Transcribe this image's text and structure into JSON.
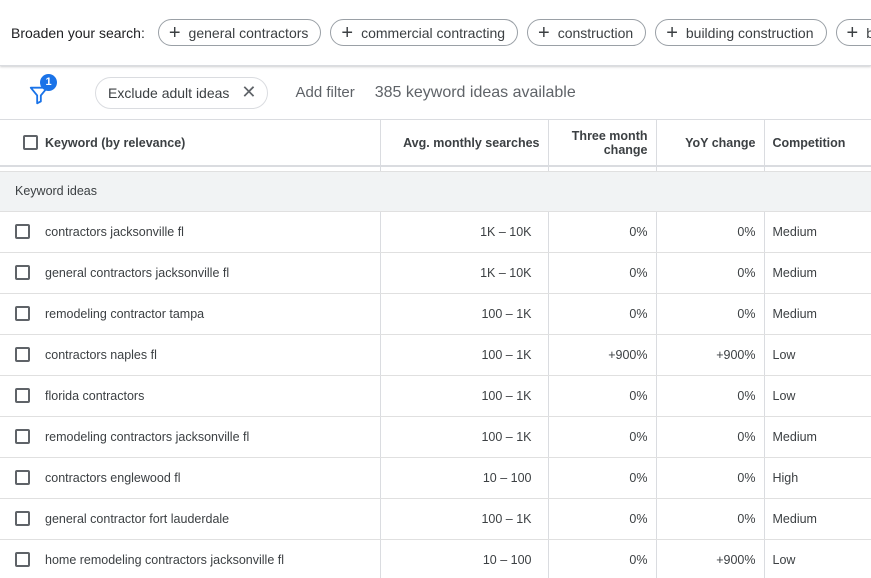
{
  "broaden": {
    "label": "Broaden your search:",
    "chips": [
      "general contractors",
      "commercial contracting",
      "construction",
      "building construction",
      "building"
    ]
  },
  "filterbar": {
    "badge_count": "1",
    "exclude_label": "Exclude adult ideas",
    "add_filter": "Add filter",
    "count_text": "385 keyword ideas available",
    "accent_color": "#1a73e8"
  },
  "table": {
    "headers": {
      "keyword": "Keyword (by relevance)",
      "avg": "Avg. monthly searches",
      "three_month": "Three month change",
      "yoy": "YoY change",
      "competition": "Competition"
    },
    "section_label": "Keyword ideas",
    "rows": [
      {
        "keyword": "contractors jacksonville fl",
        "avg": "1K – 10K",
        "three_month": "0%",
        "yoy": "0%",
        "competition": "Medium"
      },
      {
        "keyword": "general contractors jacksonville fl",
        "avg": "1K – 10K",
        "three_month": "0%",
        "yoy": "0%",
        "competition": "Medium"
      },
      {
        "keyword": "remodeling contractor tampa",
        "avg": "100 – 1K",
        "three_month": "0%",
        "yoy": "0%",
        "competition": "Medium"
      },
      {
        "keyword": "contractors naples fl",
        "avg": "100 – 1K",
        "three_month": "+900%",
        "yoy": "+900%",
        "competition": "Low"
      },
      {
        "keyword": "florida contractors",
        "avg": "100 – 1K",
        "three_month": "0%",
        "yoy": "0%",
        "competition": "Low"
      },
      {
        "keyword": "remodeling contractors jacksonville fl",
        "avg": "100 – 1K",
        "three_month": "0%",
        "yoy": "0%",
        "competition": "Medium"
      },
      {
        "keyword": "contractors englewood fl",
        "avg": "10 – 100",
        "three_month": "0%",
        "yoy": "0%",
        "competition": "High"
      },
      {
        "keyword": "general contractor fort lauderdale",
        "avg": "100 – 1K",
        "three_month": "0%",
        "yoy": "0%",
        "competition": "Medium"
      },
      {
        "keyword": "home remodeling contractors jacksonville fl",
        "avg": "10 – 100",
        "three_month": "0%",
        "yoy": "+900%",
        "competition": "Low"
      }
    ]
  }
}
